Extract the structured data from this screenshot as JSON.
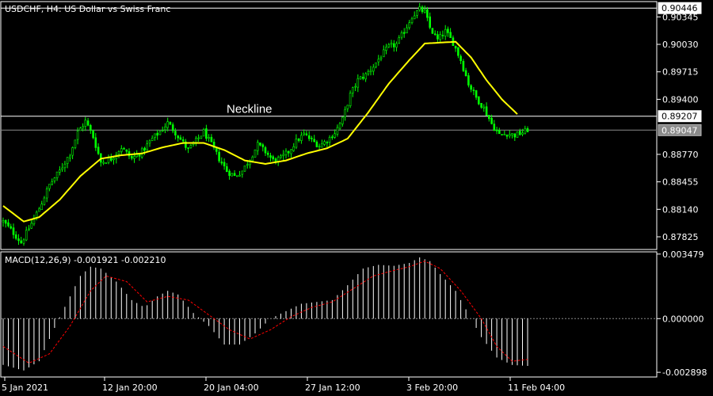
{
  "header": {
    "main_title": "USDCHF, H4:  US Dollar vs Swiss Franc",
    "macd_title": "MACD(12,26,9) -0.001921 -0.002210"
  },
  "colors": {
    "background": "#000000",
    "frame": "#ffffff",
    "candle": "#00ff00",
    "ma": "#ffff00",
    "histogram": "#ffffff",
    "signal": "#ff0000",
    "level_line": "#ffffff",
    "price_tag_line": "#8a8a8a"
  },
  "chart_data": [
    {
      "type": "candlestick",
      "symbol": "USDCHF",
      "timeframe": "H4",
      "ylim": [
        0.8768,
        0.9052
      ],
      "y_ticks": [
        "0.90345",
        "0.90030",
        "0.89715",
        "0.89400",
        "0.88770",
        "0.88455",
        "0.88140",
        "0.87825"
      ],
      "x_ticks": [
        "5 Jan 2021",
        "12 Jan 20:00",
        "20 Jan 04:00",
        "27 Jan 12:00",
        "3 Feb 20:00",
        "11 Feb 04:00"
      ],
      "levels": [
        {
          "value": 0.90446,
          "label": "0.90446"
        },
        {
          "value": 0.89207,
          "label": "0.89207"
        }
      ],
      "current_price": {
        "value": 0.89047,
        "label": "0.89047"
      },
      "annotations": [
        {
          "text": "Neckline",
          "value": 0.89207
        }
      ],
      "close_path": [
        [
          0,
          0.88
        ],
        [
          4,
          0.8787
        ],
        [
          7,
          0.8776
        ],
        [
          10,
          0.8792
        ],
        [
          14,
          0.8815
        ],
        [
          18,
          0.8842
        ],
        [
          22,
          0.8858
        ],
        [
          26,
          0.8878
        ],
        [
          29,
          0.8902
        ],
        [
          32,
          0.8915
        ],
        [
          35,
          0.8897
        ],
        [
          38,
          0.8868
        ],
        [
          42,
          0.8872
        ],
        [
          46,
          0.8885
        ],
        [
          50,
          0.8872
        ],
        [
          54,
          0.888
        ],
        [
          58,
          0.8895
        ],
        [
          61,
          0.8903
        ],
        [
          64,
          0.8913
        ],
        [
          67,
          0.8902
        ],
        [
          70,
          0.889
        ],
        [
          72,
          0.8882
        ],
        [
          75,
          0.8892
        ],
        [
          78,
          0.8903
        ],
        [
          81,
          0.8888
        ],
        [
          84,
          0.8872
        ],
        [
          87,
          0.8858
        ],
        [
          90,
          0.8852
        ],
        [
          93,
          0.8858
        ],
        [
          96,
          0.8872
        ],
        [
          99,
          0.8888
        ],
        [
          102,
          0.888
        ],
        [
          105,
          0.887
        ],
        [
          108,
          0.8872
        ],
        [
          111,
          0.888
        ],
        [
          114,
          0.8892
        ],
        [
          117,
          0.89
        ],
        [
          120,
          0.8893
        ],
        [
          123,
          0.8887
        ],
        [
          126,
          0.8893
        ],
        [
          129,
          0.8902
        ],
        [
          132,
          0.8917
        ],
        [
          135,
          0.8945
        ],
        [
          138,
          0.8962
        ],
        [
          141,
          0.8968
        ],
        [
          144,
          0.8978
        ],
        [
          147,
          0.899
        ],
        [
          150,
          0.9
        ],
        [
          153,
          0.9003
        ],
        [
          156,
          0.9018
        ],
        [
          159,
          0.9035
        ],
        [
          162,
          0.9043
        ],
        [
          164,
          0.904
        ],
        [
          166,
          0.9022
        ],
        [
          169,
          0.9008
        ],
        [
          172,
          0.9018
        ],
        [
          175,
          0.9005
        ],
        [
          178,
          0.8985
        ],
        [
          181,
          0.8958
        ],
        [
          184,
          0.8942
        ],
        [
          187,
          0.893
        ],
        [
          190,
          0.8912
        ],
        [
          193,
          0.8899
        ],
        [
          196,
          0.8901
        ],
        [
          199,
          0.8899
        ],
        [
          202,
          0.8902
        ],
        [
          204,
          0.8905
        ]
      ],
      "ma_path": [
        [
          0,
          0.8818
        ],
        [
          8,
          0.88
        ],
        [
          14,
          0.8805
        ],
        [
          22,
          0.8825
        ],
        [
          30,
          0.8852
        ],
        [
          38,
          0.8872
        ],
        [
          46,
          0.8876
        ],
        [
          54,
          0.8878
        ],
        [
          62,
          0.8885
        ],
        [
          70,
          0.889
        ],
        [
          78,
          0.889
        ],
        [
          86,
          0.8882
        ],
        [
          94,
          0.887
        ],
        [
          102,
          0.8866
        ],
        [
          110,
          0.887
        ],
        [
          118,
          0.8878
        ],
        [
          126,
          0.8884
        ],
        [
          134,
          0.8895
        ],
        [
          142,
          0.8925
        ],
        [
          150,
          0.8958
        ],
        [
          158,
          0.8985
        ],
        [
          164,
          0.9004
        ],
        [
          170,
          0.9005
        ],
        [
          176,
          0.9006
        ],
        [
          182,
          0.8988
        ],
        [
          188,
          0.8962
        ],
        [
          194,
          0.894
        ],
        [
          200,
          0.8923
        ]
      ]
    },
    {
      "type": "macd",
      "name": "MACD(12,26,9)",
      "ylim": [
        -0.00315,
        0.0036
      ],
      "y_ticks": [
        "0.003479",
        "0.000000",
        "-0.002898"
      ],
      "zero_level": 0.0,
      "histogram_path": [
        [
          0,
          -0.0025
        ],
        [
          8,
          -0.0028
        ],
        [
          14,
          -0.0023
        ],
        [
          20,
          -0.0005
        ],
        [
          26,
          0.0012
        ],
        [
          30,
          0.0023
        ],
        [
          34,
          0.0028
        ],
        [
          38,
          0.0027
        ],
        [
          44,
          0.002
        ],
        [
          50,
          0.001
        ],
        [
          55,
          0.0006
        ],
        [
          60,
          0.0012
        ],
        [
          64,
          0.0015
        ],
        [
          68,
          0.0013
        ],
        [
          74,
          0.0003
        ],
        [
          80,
          -0.0004
        ],
        [
          86,
          -0.0014
        ],
        [
          92,
          -0.0014
        ],
        [
          98,
          -0.0008
        ],
        [
          104,
          0.0
        ],
        [
          110,
          0.0004
        ],
        [
          116,
          0.0008
        ],
        [
          122,
          0.0009
        ],
        [
          128,
          0.001
        ],
        [
          134,
          0.0018
        ],
        [
          140,
          0.0027
        ],
        [
          146,
          0.0029
        ],
        [
          152,
          0.00285
        ],
        [
          158,
          0.003
        ],
        [
          162,
          0.0033
        ],
        [
          166,
          0.0031
        ],
        [
          170,
          0.0024
        ],
        [
          176,
          0.0015
        ],
        [
          182,
          0.0
        ],
        [
          186,
          -0.001
        ],
        [
          192,
          -0.0021
        ],
        [
          198,
          -0.0025
        ],
        [
          204,
          -0.00255
        ]
      ],
      "signal_path": [
        [
          0,
          -0.0015
        ],
        [
          10,
          -0.0024
        ],
        [
          18,
          -0.0019
        ],
        [
          26,
          -0.0004
        ],
        [
          34,
          0.0015
        ],
        [
          40,
          0.0023
        ],
        [
          48,
          0.002
        ],
        [
          56,
          0.0009
        ],
        [
          64,
          0.0012
        ],
        [
          72,
          0.001
        ],
        [
          80,
          0.0002
        ],
        [
          88,
          -0.0006
        ],
        [
          96,
          -0.0011
        ],
        [
          104,
          -0.0006
        ],
        [
          112,
          0.0001
        ],
        [
          120,
          0.0006
        ],
        [
          128,
          0.0009
        ],
        [
          136,
          0.0016
        ],
        [
          144,
          0.0023
        ],
        [
          152,
          0.0026
        ],
        [
          158,
          0.0028
        ],
        [
          164,
          0.0031
        ],
        [
          170,
          0.0027
        ],
        [
          178,
          0.0015
        ],
        [
          186,
          0.0
        ],
        [
          192,
          -0.0015
        ],
        [
          198,
          -0.0023
        ],
        [
          204,
          -0.0022
        ]
      ]
    }
  ]
}
